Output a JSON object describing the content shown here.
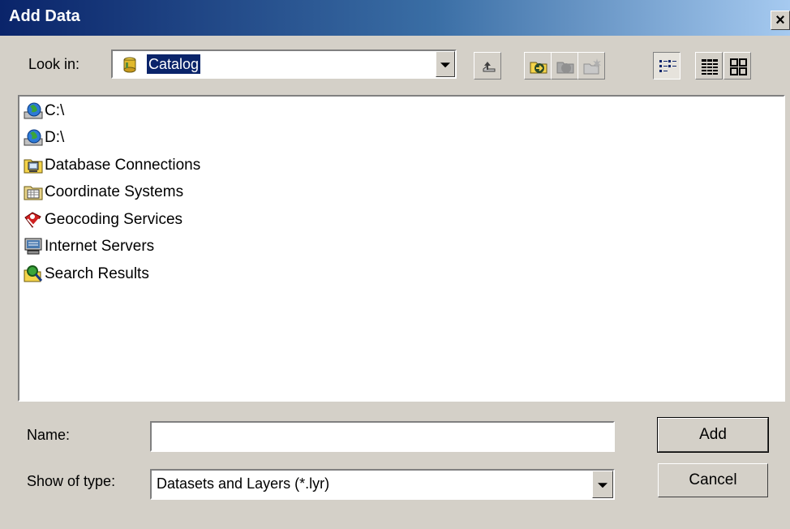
{
  "window": {
    "title": "Add Data",
    "close_glyph": "×"
  },
  "lookin": {
    "label": "Look in:",
    "value": "Catalog",
    "icon": "catalog-icon"
  },
  "toolbar": [
    {
      "name": "up-one-level-button",
      "icon": "up-arrow-icon"
    },
    {
      "name": "connect-to-folder-button",
      "icon": "connect-folder-icon"
    },
    {
      "name": "disconnect-folder-button",
      "icon": "disconnect-folder-icon",
      "disabled": true
    },
    {
      "name": "new-folder-button",
      "icon": "new-folder-icon",
      "disabled": true
    },
    {
      "name": "list-view-button",
      "icon": "list-view-icon",
      "pressed": true
    },
    {
      "name": "details-view-button",
      "icon": "details-view-icon"
    },
    {
      "name": "thumbnails-view-button",
      "icon": "thumbnails-view-icon"
    }
  ],
  "items": [
    {
      "label": "C:\\",
      "icon": "drive-icon"
    },
    {
      "label": "D:\\",
      "icon": "drive-icon"
    },
    {
      "label": "Database Connections",
      "icon": "database-connections-icon"
    },
    {
      "label": "Coordinate Systems",
      "icon": "coordinate-systems-icon"
    },
    {
      "label": "Geocoding Services",
      "icon": "geocoding-services-icon"
    },
    {
      "label": "Internet Servers",
      "icon": "internet-servers-icon"
    },
    {
      "label": "Search Results",
      "icon": "search-results-icon"
    }
  ],
  "name_field": {
    "label": "Name:",
    "value": ""
  },
  "type_field": {
    "label": "Show of type:",
    "value": "Datasets and Layers (*.lyr)"
  },
  "buttons": {
    "add": "Add",
    "cancel": "Cancel"
  }
}
